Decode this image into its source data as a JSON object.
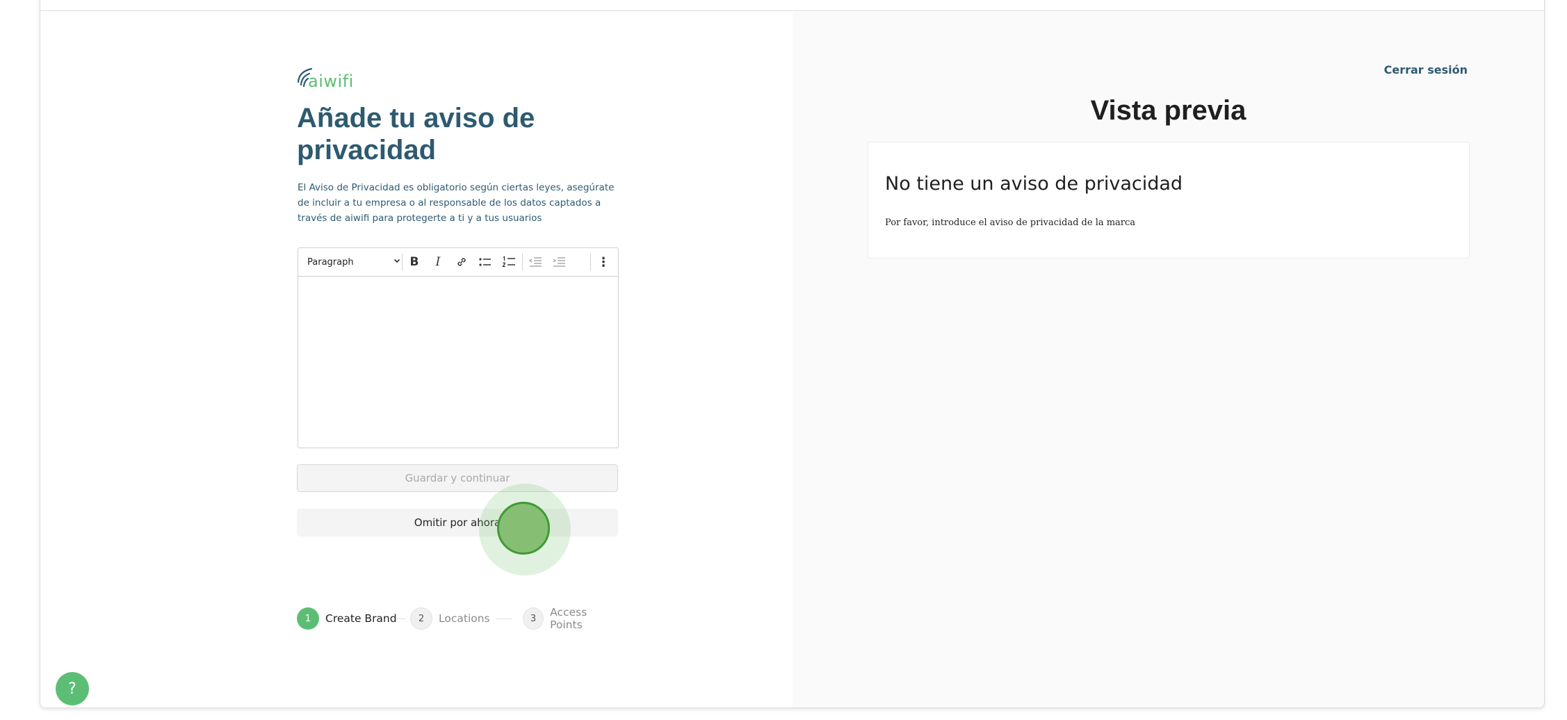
{
  "brand": {
    "logo_text": "aiwifi",
    "accent_color": "#5cbe74",
    "text_color": "#2e5a70"
  },
  "left": {
    "title": "Añade tu aviso de privacidad",
    "description": "El Aviso de Privacidad es obligatorio según ciertas leyes, asegúrate de incluir a tu empresa o al responsable de los datos captados a través de aiwifi para protegerte a ti y a tus usuarios",
    "editor": {
      "format_select": "Paragraph",
      "toolbar_icons": [
        "bold-icon",
        "italic-icon",
        "link-icon",
        "bullet-list-icon",
        "numbered-list-icon",
        "outdent-icon",
        "indent-icon",
        "more-vertical-icon"
      ],
      "bold_glyph": "B",
      "italic_glyph": "I",
      "more_glyph": "⋮",
      "content": ""
    },
    "save_button": "Guardar y continuar",
    "skip_button": "Omitir por ahora",
    "steps": [
      {
        "number": "1",
        "label": "Create Brand",
        "active": true
      },
      {
        "number": "2",
        "label": "Locations",
        "active": false
      },
      {
        "number": "3",
        "label": "Access Points",
        "active": false
      }
    ],
    "help_button": "?"
  },
  "right": {
    "logout": "Cerrar sesión",
    "preview_title": "Vista previa",
    "preview_card": {
      "title": "No tiene un aviso de privacidad",
      "text": "Por favor, introduce el aviso de privacidad de la marca"
    }
  }
}
